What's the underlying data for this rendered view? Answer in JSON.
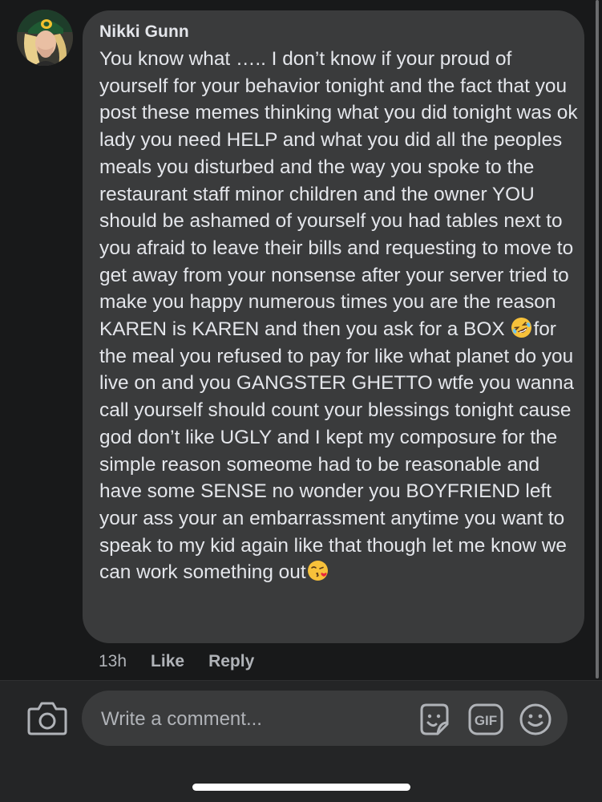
{
  "comment": {
    "author": "Nikki Gunn",
    "text_part1": "You know what ….. I don’t know if your proud of yourself for your behavior tonight and the fact that you post these memes thinking what you did tonight was ok lady you need HELP and what you did all the peoples meals you disturbed and the way you spoke to the restaurant staff minor children and the owner YOU should be ashamed of yourself you had tables next to you afraid to leave their bills and requesting to move to get away from your nonsense after your server tried to make you happy numerous times you are the reason KAREN is KAREN and then you ask for a BOX ",
    "emoji1": "rolling-on-floor-laughing-emoji",
    "text_part2": "for the meal you refused to pay for like what planet do you live on and you GANGSTER GHETTO wtfe you wanna call yourself should count your blessings tonight cause god don’t like UGLY and I kept my composure for the simple reason someome had to be reasonable and have some SENSE no wonder you BOYFRIEND left your ass your an embarrassment anytime you want to speak to my kid again like that though let me know we can work something out",
    "emoji2": "face-blowing-a-kiss-emoji"
  },
  "meta": {
    "time": "13h",
    "like_label": "Like",
    "reply_label": "Reply"
  },
  "composer": {
    "placeholder": "Write a comment...",
    "gif_label": "GIF",
    "camera_icon": "camera-icon",
    "sticker_icon": "sticker-icon",
    "emoji_icon": "smiley-icon"
  },
  "colors": {
    "background": "#18191a",
    "bubble": "#3a3b3c",
    "text": "#e4e6eb",
    "secondary_text": "#b0b3b8",
    "composer_bar": "#242526"
  }
}
